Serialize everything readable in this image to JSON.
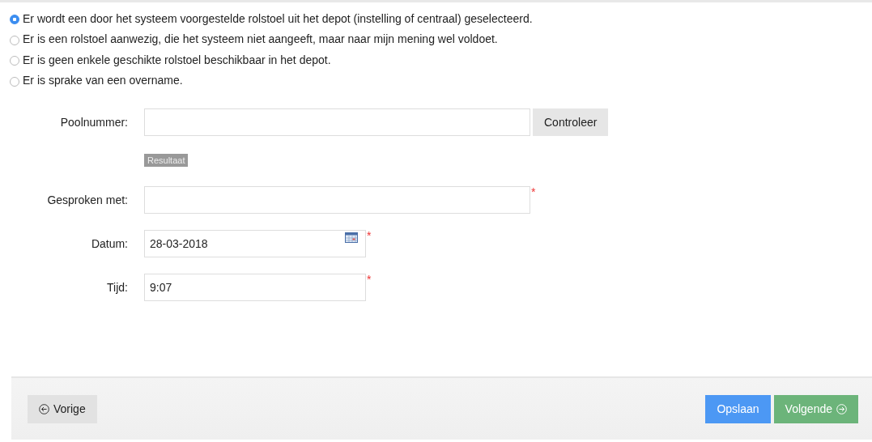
{
  "options": [
    {
      "label": "Er wordt een door het systeem voorgestelde rolstoel uit het depot (instelling of centraal) geselecteerd.",
      "selected": true
    },
    {
      "label": "Er is een rolstoel aanwezig, die het systeem niet aangeeft, maar naar mijn mening wel voldoet.",
      "selected": false
    },
    {
      "label": "Er is geen enkele geschikte rolstoel beschikbaar in het depot.",
      "selected": false
    },
    {
      "label": "Er is sprake van een overname.",
      "selected": false
    }
  ],
  "form": [
    {
      "kind": "check",
      "label": "Poolnummer:",
      "button": "Controleer",
      "result": "Resultaat"
    },
    {
      "kind": "text",
      "label": "Gesproken met:",
      "required_mark": "*"
    },
    {
      "kind": "date",
      "label": "Datum:",
      "value": "28-03-2018",
      "required_mark": "*"
    },
    {
      "kind": "short",
      "label": "Tijd:",
      "value": "9:07",
      "required_mark": "*"
    }
  ],
  "footer": {
    "back": "Vorige",
    "save": "Opslaan",
    "next": "Volgende"
  }
}
